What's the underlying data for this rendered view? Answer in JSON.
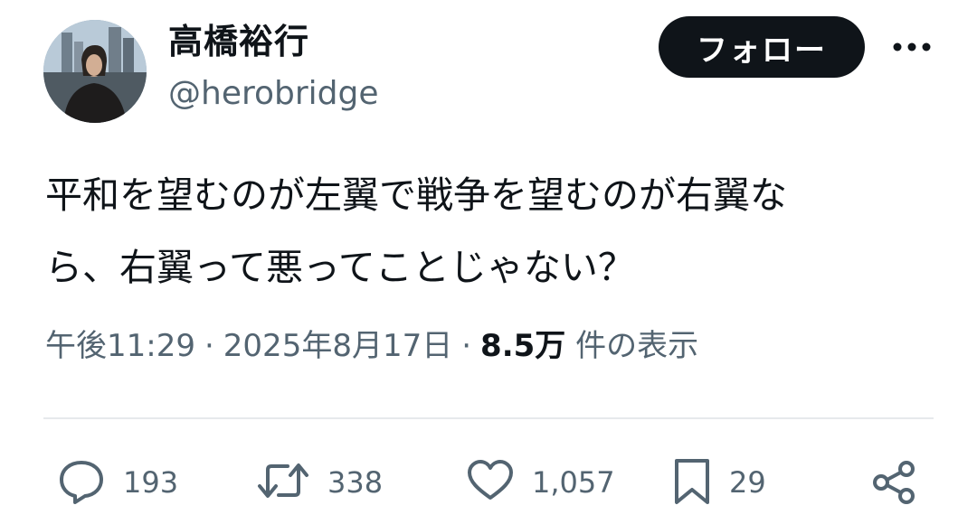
{
  "author": {
    "display_name": "高橋裕行",
    "handle": "@herobridge"
  },
  "follow_button": {
    "label": "フォロー"
  },
  "tweet": {
    "line1": "平和を望むのが左翼で戦争を望むのが右翼な",
    "line2": "ら、右翼って悪ってことじゃない？"
  },
  "meta": {
    "time": "午後11:29",
    "separator": "·",
    "date": "2025年8月17日",
    "views_count": "8.5万",
    "views_label": "件の表示"
  },
  "actions": {
    "replies": "193",
    "retweets": "338",
    "likes": "1,057",
    "bookmarks": "29"
  },
  "icons": {
    "reply": "reply-icon",
    "retweet": "retweet-icon",
    "like": "heart-icon",
    "bookmark": "bookmark-icon",
    "share": "share-icon",
    "more": "more-icon"
  },
  "colors": {
    "text": "#0f1419",
    "secondary": "#536471",
    "button_bg": "#0f1419",
    "divider": "#e6e9ec"
  }
}
